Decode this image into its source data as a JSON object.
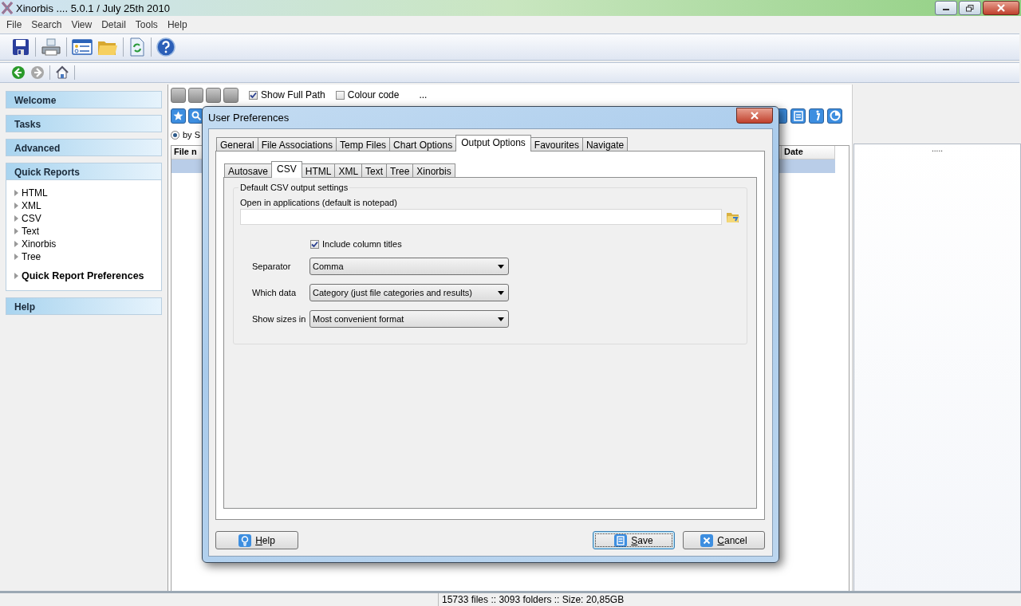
{
  "window": {
    "title": "Xinorbis .... 5.0.1 / July 25th 2010"
  },
  "menu": [
    "File",
    "Search",
    "View",
    "Detail",
    "Tools",
    "Help"
  ],
  "sidebar": {
    "sections": [
      {
        "title": "Welcome",
        "expanded": false
      },
      {
        "title": "Tasks",
        "expanded": false
      },
      {
        "title": "Advanced",
        "expanded": false
      },
      {
        "title": "Quick Reports",
        "expanded": true,
        "items": [
          {
            "label": "HTML",
            "kind": "report"
          },
          {
            "label": "XML",
            "kind": "report"
          },
          {
            "label": "CSV",
            "kind": "report"
          },
          {
            "label": "Text",
            "kind": "report"
          },
          {
            "label": "Xinorbis",
            "kind": "report"
          },
          {
            "label": "Tree",
            "kind": "report"
          },
          {
            "label": "Quick Report Preferences",
            "kind": "preferences"
          }
        ]
      },
      {
        "title": "Help",
        "expanded": false
      }
    ]
  },
  "content": {
    "options": [
      {
        "label": "Show Full Path",
        "checked": true
      },
      {
        "label": "Colour code",
        "checked": false
      }
    ],
    "more": "...",
    "radio": {
      "label": "by S",
      "selected": true
    },
    "table": {
      "columns": [
        "File n",
        "Date"
      ]
    },
    "side_panel": {
      "text": "....."
    }
  },
  "dialog": {
    "title": "User Preferences",
    "tabs": [
      {
        "label": "General",
        "selected": false
      },
      {
        "label": "File Associations",
        "selected": false
      },
      {
        "label": "Temp Files",
        "selected": false
      },
      {
        "label": "Chart Options",
        "selected": false
      },
      {
        "label": "Output Options",
        "selected": true
      },
      {
        "label": "Favourites",
        "selected": false
      },
      {
        "label": "Navigate",
        "selected": false
      }
    ],
    "subtabs": [
      {
        "label": "Autosave",
        "selected": false
      },
      {
        "label": "CSV",
        "selected": true
      },
      {
        "label": "HTML",
        "selected": false
      },
      {
        "label": "XML",
        "selected": false
      },
      {
        "label": "Text",
        "selected": false
      },
      {
        "label": "Tree",
        "selected": false
      },
      {
        "label": "Xinorbis",
        "selected": false
      }
    ],
    "group": {
      "title": "Default CSV output settings",
      "app_label": "Open in applications (default is notepad)",
      "include_titles": {
        "label": "Include column titles",
        "checked": true
      },
      "fields": [
        {
          "label": "Separator",
          "value": "Comma"
        },
        {
          "label": "Which data",
          "value": "Category (just file categories and results)"
        },
        {
          "label": "Show sizes in",
          "value": "Most convenient format"
        }
      ]
    },
    "buttons": [
      {
        "label": "Help",
        "kind": "help",
        "focused": false
      },
      {
        "label": "Save",
        "kind": "save",
        "focused": true
      },
      {
        "label": "Cancel",
        "kind": "cancel",
        "focused": false
      }
    ]
  },
  "status_bar": {
    "text": "15733 files  ::  3093 folders  ::  Size: 20,85GB"
  }
}
